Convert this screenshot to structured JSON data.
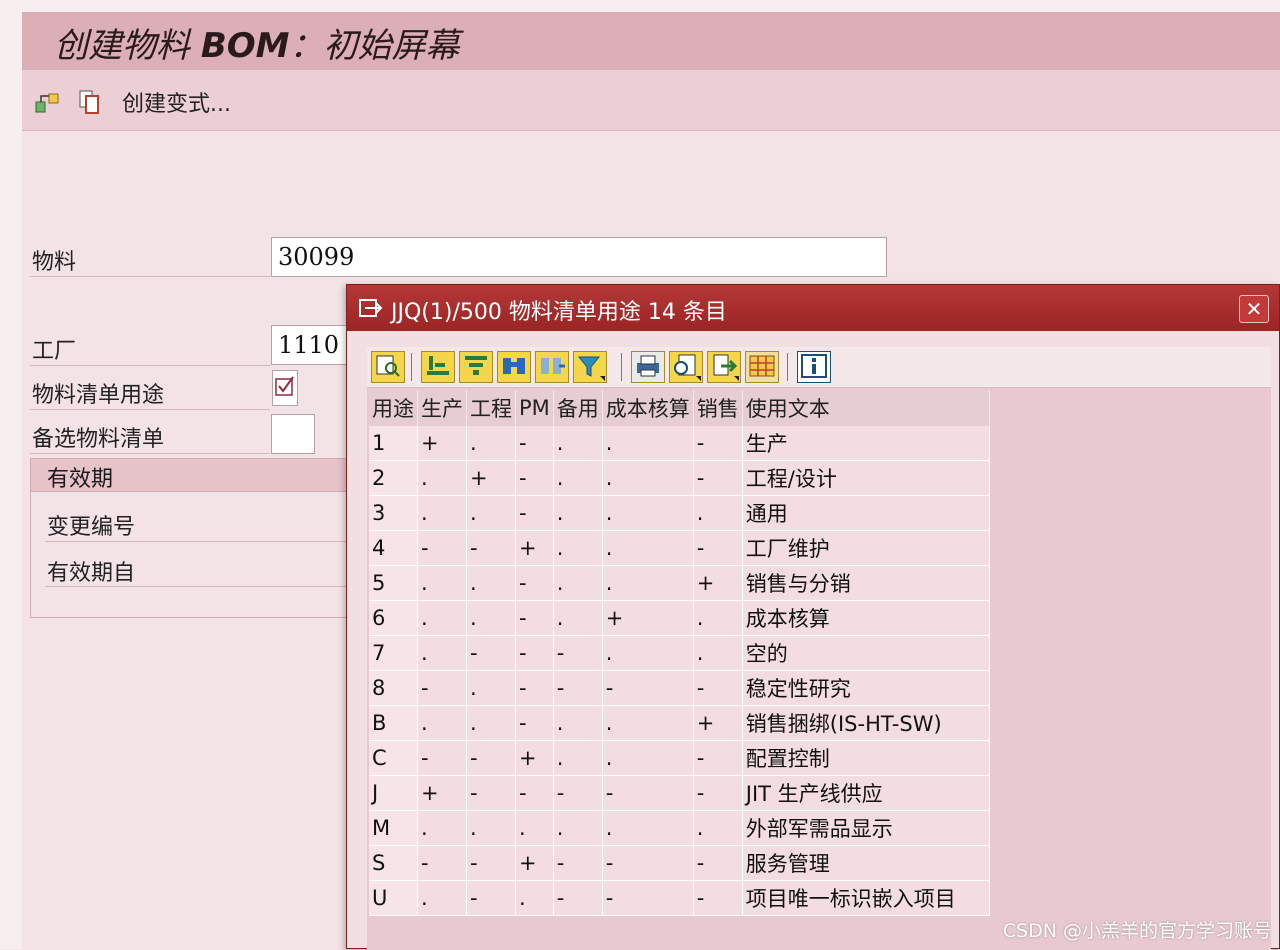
{
  "app": {
    "title_prefix": "创建物料 ",
    "title_bold": "BOM",
    "title_suffix": "：初始屏幕"
  },
  "toolbar": {
    "variant_label": "创建变式..."
  },
  "form": {
    "material_label": "物料",
    "material_value": "30099",
    "plant_label": "工厂",
    "plant_value": "1110",
    "bom_usage_label": "物料清单用途",
    "alt_bom_label": "备选物料清单",
    "validity_group_title": "有效期",
    "change_number_label": "变更编号",
    "valid_from_label": "有效期自"
  },
  "dialog": {
    "title": "JJQ(1)/500 物料清单用途 14 条目",
    "close_symbol": "✕",
    "columns": [
      "用途",
      "生产",
      "工程",
      "PM",
      "备用",
      "成本核算",
      "销售",
      "使用文本"
    ],
    "rows": [
      [
        "1",
        "+",
        ".",
        "-",
        ".",
        ".",
        "-",
        "生产"
      ],
      [
        "2",
        ".",
        "+",
        "-",
        ".",
        ".",
        "-",
        "工程/设计"
      ],
      [
        "3",
        ".",
        ".",
        "-",
        ".",
        ".",
        ".",
        "通用"
      ],
      [
        "4",
        "-",
        "-",
        "+",
        ".",
        ".",
        "-",
        "工厂维护"
      ],
      [
        "5",
        ".",
        ".",
        "-",
        ".",
        ".",
        "+",
        "销售与分销"
      ],
      [
        "6",
        ".",
        ".",
        "-",
        ".",
        "+",
        ".",
        "成本核算"
      ],
      [
        "7",
        ".",
        "-",
        "-",
        "-",
        ".",
        ".",
        "空的"
      ],
      [
        "8",
        "-",
        ".",
        "-",
        "-",
        "-",
        "-",
        "稳定性研究"
      ],
      [
        "B",
        ".",
        ".",
        "-",
        ".",
        ".",
        "+",
        "销售捆绑(IS-HT-SW)"
      ],
      [
        "C",
        "-",
        "-",
        "+",
        ".",
        ".",
        "-",
        "配置控制"
      ],
      [
        "J",
        "+",
        "-",
        "-",
        "-",
        "-",
        "-",
        "JIT 生产线供应"
      ],
      [
        "M",
        ".",
        ".",
        ".",
        ".",
        ".",
        ".",
        "外部军需品显示"
      ],
      [
        "S",
        "-",
        "-",
        "+",
        "-",
        "-",
        "-",
        "服务管理"
      ],
      [
        "U",
        ".",
        "-",
        ".",
        "-",
        "-",
        "-",
        "项目唯一标识嵌入项目"
      ]
    ]
  },
  "watermark": "CSDN @小羔羊的官方学习账号"
}
